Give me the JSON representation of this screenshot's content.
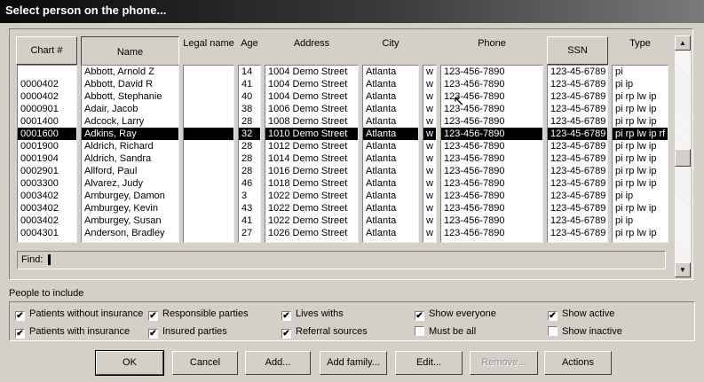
{
  "window": {
    "title": "Select person on the phone..."
  },
  "columns": {
    "chart": "Chart #",
    "name": "Name",
    "legal_name": "Legal name",
    "age": "Age",
    "address": "Address",
    "city": "City",
    "phone": "Phone",
    "ssn": "SSN",
    "type": "Type"
  },
  "rows": [
    {
      "chart": "",
      "name": "Abbott, Arnold Z",
      "legal": "",
      "age": "14",
      "address": "1004 Demo Street",
      "city": "Atlanta",
      "w": "w",
      "phone": "123-456-7890",
      "ssn": "123-45-6789",
      "type": "pi"
    },
    {
      "chart": "0000402",
      "name": "Abbott, David R",
      "legal": "",
      "age": "41",
      "address": "1004 Demo Street",
      "city": "Atlanta",
      "w": "w",
      "phone": "123-456-7890",
      "ssn": "123-45-6789",
      "type": "pi ip"
    },
    {
      "chart": "0000402",
      "name": "Abbott, Stephanie",
      "legal": "",
      "age": "40",
      "address": "1004 Demo Street",
      "city": "Atlanta",
      "w": "w",
      "phone": "123-456-7890",
      "ssn": "123-45-6789",
      "type": "pi rp lw ip"
    },
    {
      "chart": "0000901",
      "name": "Adair, Jacob",
      "legal": "",
      "age": "38",
      "address": "1006 Demo Street",
      "city": "Atlanta",
      "w": "w",
      "phone": "123-456-7890",
      "ssn": "123-45-6789",
      "type": "pi rp lw ip"
    },
    {
      "chart": "0001400",
      "name": "Adcock, Larry",
      "legal": "",
      "age": "28",
      "address": "1008 Demo Street",
      "city": "Atlanta",
      "w": "w",
      "phone": "123-456-7890",
      "ssn": "123-45-6789",
      "type": "pi rp lw ip"
    },
    {
      "chart": "0001600",
      "name": "Adkins, Ray",
      "legal": "",
      "age": "32",
      "address": "1010 Demo Street",
      "city": "Atlanta",
      "w": "w",
      "phone": "123-456-7890",
      "ssn": "123-45-6789",
      "type": "pi rp lw ip rf"
    },
    {
      "chart": "0001900",
      "name": "Aldrich, Richard",
      "legal": "",
      "age": "28",
      "address": "1012 Demo Street",
      "city": "Atlanta",
      "w": "w",
      "phone": "123-456-7890",
      "ssn": "123-45-6789",
      "type": "pi rp lw ip"
    },
    {
      "chart": "0001904",
      "name": "Aldrich, Sandra",
      "legal": "",
      "age": "28",
      "address": "1014 Demo Street",
      "city": "Atlanta",
      "w": "w",
      "phone": "123-456-7890",
      "ssn": "123-45-6789",
      "type": "pi rp lw ip"
    },
    {
      "chart": "0002901",
      "name": "Allford, Paul",
      "legal": "",
      "age": "28",
      "address": "1016 Demo Street",
      "city": "Atlanta",
      "w": "w",
      "phone": "123-456-7890",
      "ssn": "123-45-6789",
      "type": "pi rp lw ip"
    },
    {
      "chart": "0003300",
      "name": "Alvarez, Judy",
      "legal": "",
      "age": "46",
      "address": "1018 Demo Street",
      "city": "Atlanta",
      "w": "w",
      "phone": "123-456-7890",
      "ssn": "123-45-6789",
      "type": "pi rp lw ip"
    },
    {
      "chart": "0003402",
      "name": "Amburgey, Damon",
      "legal": "",
      "age": "3",
      "address": "1022 Demo Street",
      "city": "Atlanta",
      "w": "w",
      "phone": "123-456-7890",
      "ssn": "123-45-6789",
      "type": "pi ip"
    },
    {
      "chart": "0003402",
      "name": "Amburgey, Kevin",
      "legal": "",
      "age": "43",
      "address": "1022 Demo Street",
      "city": "Atlanta",
      "w": "w",
      "phone": "123-456-7890",
      "ssn": "123-45-6789",
      "type": "pi rp lw ip"
    },
    {
      "chart": "0003402",
      "name": "Amburgey, Susan",
      "legal": "",
      "age": "41",
      "address": "1022 Demo Street",
      "city": "Atlanta",
      "w": "w",
      "phone": "123-456-7890",
      "ssn": "123-45-6789",
      "type": "pi ip"
    },
    {
      "chart": "0004301",
      "name": "Anderson, Bradley",
      "legal": "",
      "age": "27",
      "address": "1026 Demo Street",
      "city": "Atlanta",
      "w": "w",
      "phone": "123-456-7890",
      "ssn": "123-45-6789",
      "type": "pi rp lw ip"
    }
  ],
  "selected_row": 5,
  "find": {
    "label": "Find:",
    "value": ""
  },
  "filters": {
    "label": "People to include",
    "items": [
      {
        "label": "Patients without insurance",
        "checked": true
      },
      {
        "label": "Patients with insurance",
        "checked": true
      },
      {
        "label": "Responsible parties",
        "checked": true
      },
      {
        "label": "Insured parties",
        "checked": true
      },
      {
        "label": "Lives withs",
        "checked": true
      },
      {
        "label": "Referral sources",
        "checked": true
      },
      {
        "label": "Show everyone",
        "checked": true
      },
      {
        "label": "Must be all",
        "checked": false
      },
      {
        "label": "Show active",
        "checked": true
      },
      {
        "label": "Show inactive",
        "checked": false
      }
    ]
  },
  "buttons": {
    "ok": "OK",
    "cancel": "Cancel",
    "add": "Add...",
    "add_family": "Add family...",
    "edit": "Edit...",
    "remove": "Remove...",
    "actions": "Actions"
  }
}
